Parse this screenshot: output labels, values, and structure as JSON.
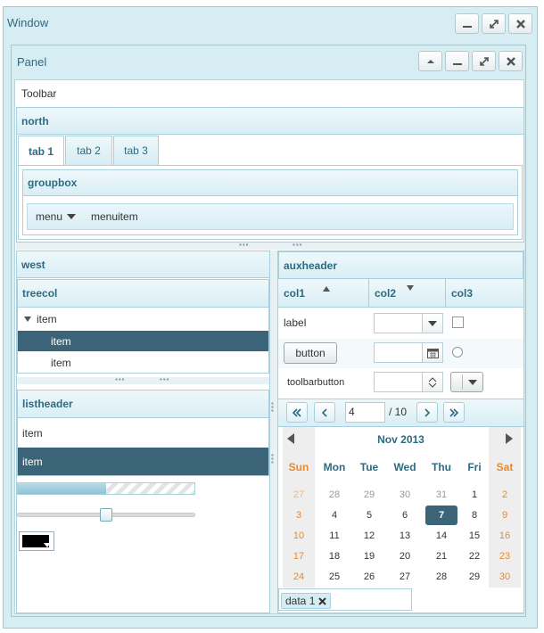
{
  "window": {
    "title": "Window"
  },
  "panel": {
    "title": "Panel"
  },
  "toolbar": {
    "label": "Toolbar"
  },
  "north": {
    "title": "north",
    "tabs": [
      {
        "label": "tab 1",
        "selected": true
      },
      {
        "label": "tab 2",
        "selected": false
      },
      {
        "label": "tab 3",
        "selected": false
      }
    ],
    "groupbox": {
      "title": "groupbox",
      "menu_label": "menu",
      "menuitem_label": "menuitem"
    }
  },
  "west": {
    "title": "west",
    "tree": {
      "column": "treecol",
      "items": [
        "item",
        "item",
        "item"
      ]
    },
    "listbox": {
      "header": "listheader",
      "items": [
        "item",
        "item"
      ]
    },
    "progress_percent": 50,
    "slider_percent": 50,
    "colorbox_value": "#000000"
  },
  "center": {
    "auxheader": "auxheader",
    "columns": [
      "col1",
      "col2",
      "col3"
    ],
    "row1_label": "label",
    "row2_button": "button",
    "row3_toolbarbutton": "toolbarbutton",
    "paging": {
      "page": "4",
      "total": "/ 10"
    },
    "calendar": {
      "month": "Nov 2013",
      "weekdays": [
        "Sun",
        "Mon",
        "Tue",
        "Wed",
        "Thu",
        "Fri",
        "Sat"
      ],
      "weeks": [
        [
          "27",
          "28",
          "29",
          "30",
          "31",
          "1",
          "2"
        ],
        [
          "3",
          "4",
          "5",
          "6",
          "7",
          "8",
          "9"
        ],
        [
          "10",
          "11",
          "12",
          "13",
          "14",
          "15",
          "16"
        ],
        [
          "17",
          "18",
          "19",
          "20",
          "21",
          "22",
          "23"
        ],
        [
          "24",
          "25",
          "26",
          "27",
          "28",
          "29",
          "30"
        ]
      ],
      "selected": "7"
    },
    "chosenbox": {
      "chip_label": "data 1"
    }
  }
}
